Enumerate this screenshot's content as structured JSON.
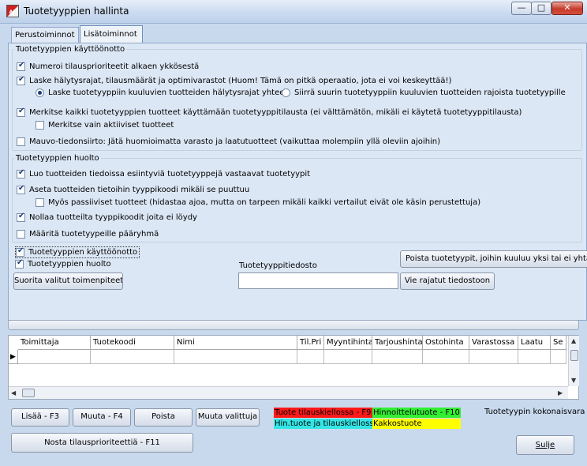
{
  "window": {
    "title": "Tuotetyyppien hallinta",
    "icon_text": "AF"
  },
  "window_buttons": {
    "minimize": "—",
    "maximize": "□",
    "close": "✕"
  },
  "tabs": {
    "perus": "Perustoiminnot",
    "lisa": "Lisätoiminnot"
  },
  "kayttoonotto": {
    "legend": "Tuotetyyppien käyttöönotto",
    "numeroi": {
      "label": "Numeroi tilausprioriteetit alkaen ykkösestä",
      "checked": true
    },
    "laske": {
      "label": "Laske hälytysrajat, tilausmäärät ja optimivarastot (Huom! Tämä on pitkä operaatio, jota ei voi keskeyttää!)",
      "checked": true
    },
    "radio_laske": {
      "label": "Laske tuotetyyppiin kuuluvien tuotteiden hälytysrajat yhteen",
      "checked": true
    },
    "radio_siirra": {
      "label": "Siirrä suurin tuotetyyppiin kuuluvien tuotteiden rajoista tuotetyypille",
      "checked": false
    },
    "merkitse": {
      "label": "Merkitse kaikki tuotetyyppien tuotteet käyttämään tuotetyyppitilausta (ei välttämätön, mikäli ei käytetä tuotetyyppitilausta)",
      "checked": true
    },
    "merkitse_aktiiviset": {
      "label": "Merkitse vain aktiiviset tuotteet",
      "checked": false
    },
    "mauvo": {
      "label": "Mauvo-tiedonsiirto: Jätä huomioimatta varasto ja laatutuotteet (vaikuttaa molempiin yllä oleviin ajoihin)",
      "checked": false
    }
  },
  "huolto": {
    "legend": "Tuotetyyppien huolto",
    "luo": {
      "label": "Luo tuotteiden tiedoissa esiintyviä tuotetyyppejä vastaavat tuotetyypit",
      "checked": true
    },
    "aseta": {
      "label": "Aseta tuotteiden tietoihin tyyppikoodi mikäli se puuttuu",
      "checked": true
    },
    "passiiviset": {
      "label": "Myös passiiviset tuotteet (hidastaa ajoa, mutta on tarpeen mikäli kaikki vertailut eivät ole käsin perustettuja)",
      "checked": false
    },
    "nollaa": {
      "label": "Nollaa tuotteilta tyyppikoodit joita ei löydy",
      "checked": true
    },
    "maarita": {
      "label": "Määritä tuotetyypeille pääryhmä",
      "checked": false
    }
  },
  "actions": {
    "run_kayttoonotto": {
      "label": "Tuotetyyppien käyttöönotto",
      "checked": true
    },
    "run_huolto": {
      "label": "Tuotetyyppien huolto",
      "checked": true
    },
    "suorita_button": "Suorita valitut toimenpiteet",
    "file_label": "Tuotetyyppitiedosto",
    "file_value": "",
    "poista_button": "Poista tuotetyypit, joihin kuuluu yksi tai ei yhtään tuotetta",
    "vie_button": "Vie rajatut tiedostoon"
  },
  "grid": {
    "columns": [
      "Toimittaja",
      "Tuotekoodi",
      "Nimi",
      "Til.Pri",
      "Myyntihinta",
      "Tarjoushinta",
      "Ostohinta",
      "Varastossa",
      "Laatu",
      "Se"
    ],
    "row_indicator": "▶"
  },
  "bottom": {
    "lisaa_button": "Lisää - F3",
    "muuta_button": "Muuta - F4",
    "poista_button": "Poista",
    "muuta_valittuja_button": "Muuta valittuja",
    "nosta_button": "Nosta tilausprioriteettiä - F11",
    "sulje_button": "Sulje",
    "kokonaisvara_label": "Tuotetyypin kokonaisvara"
  },
  "color_legend": {
    "kielto": {
      "label": "Tuote tilauskiellossa - F9",
      "color": "#ff1a1a"
    },
    "hinnoittelu": {
      "label": "Hinnoittelutuote - F10",
      "color": "#33ee33"
    },
    "hin_kielto": {
      "label": "Hin.tuote ja tilauskiellossa",
      "color": "#33e6e6"
    },
    "kakkos": {
      "label": "Kakkostuote",
      "color": "#ffff00"
    }
  }
}
